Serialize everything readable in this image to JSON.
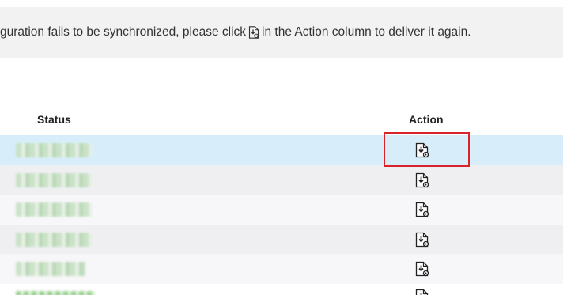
{
  "notice": {
    "text_before": "guration fails to be synchronized, please click",
    "text_after": "in the Action column to deliver it again.",
    "icon": "deliver-config-icon"
  },
  "table": {
    "columns": [
      "Status",
      "Action"
    ],
    "rows": [
      {
        "status": "",
        "action_icon": "deliver-config-icon",
        "selected": true
      },
      {
        "status": "",
        "action_icon": "deliver-config-icon",
        "selected": false
      },
      {
        "status": "",
        "action_icon": "deliver-config-icon",
        "selected": false
      },
      {
        "status": "",
        "action_icon": "deliver-config-icon",
        "selected": false
      },
      {
        "status": "",
        "action_icon": "deliver-config-icon",
        "selected": false
      },
      {
        "status": "",
        "action_icon": "deliver-config-icon",
        "selected": false
      }
    ]
  },
  "colors": {
    "selected_row": "#d7eefa",
    "highlight_border": "#d9222a",
    "status_text": "#4caf50",
    "notice_background": "#f2f2f2"
  }
}
